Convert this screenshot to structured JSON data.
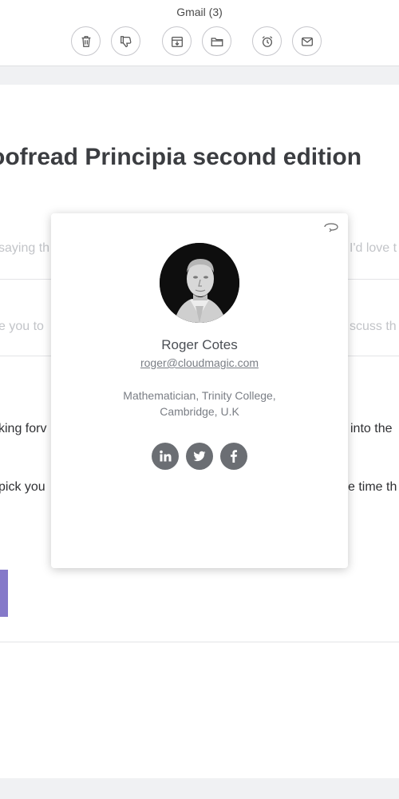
{
  "toolbar": {
    "title": "Gmail (3)",
    "buttons": [
      "trash-icon",
      "thumbs-down-icon",
      "archive-icon",
      "folder-icon",
      "alarm-clock-icon",
      "envelope-icon"
    ]
  },
  "email": {
    "subject": "oofread Principia second edition",
    "preview_lines": [
      {
        "left": "saying th",
        "right": "I'd love t"
      },
      {
        "left": "e you to",
        "right": "scuss th"
      }
    ],
    "body_lines": [
      {
        "left": "king forv",
        "right": "into the"
      },
      {
        "left": "pick you",
        "right": "e time th"
      }
    ]
  },
  "contact_card": {
    "name": "Roger Cotes",
    "email": "roger@cloudmagic.com",
    "job_line1": "Mathematician, Trinity College,",
    "job_line2": "Cambridge, U.K",
    "socials": [
      "linkedin-icon",
      "twitter-icon",
      "facebook-icon"
    ]
  },
  "colors": {
    "accent": "#8579c9",
    "icon_gray": "#6b6e73",
    "page_bg": "#f0f1f3"
  }
}
